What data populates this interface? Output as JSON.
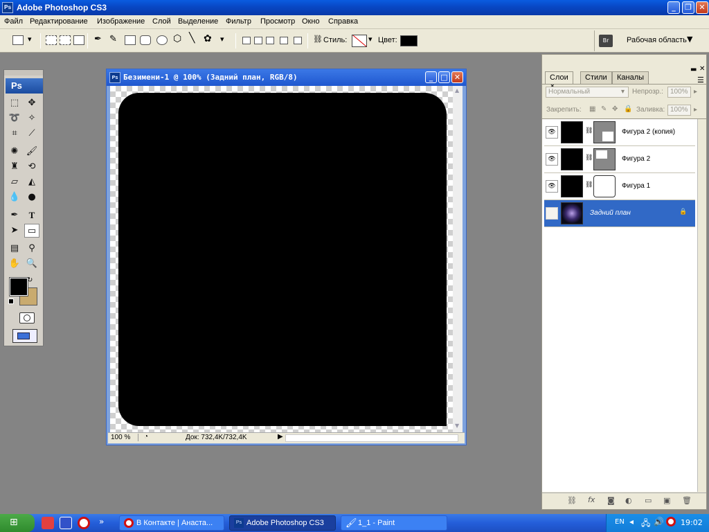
{
  "app": {
    "title": "Adobe Photoshop CS3",
    "ps_icon": "Ps"
  },
  "menu": [
    "Файл",
    "Редактирование",
    "Изображение",
    "Слой",
    "Выделение",
    "Фильтр",
    "Просмотр",
    "Окно",
    "Справка"
  ],
  "options_bar": {
    "style_label": "Стиль:",
    "color_label": "Цвет:",
    "color_value": "#000000",
    "workspace_label": "Рабочая область"
  },
  "toolbox": {
    "logo": "Ps",
    "foreground_color": "#000000",
    "background_color": "#c9ab6f",
    "tools": [
      "marquee-icon",
      "move-icon",
      "lasso-icon",
      "magic-wand-icon",
      "crop-icon",
      "slice-icon",
      "healing-brush-icon",
      "brush-icon",
      "clone-stamp-icon",
      "history-brush-icon",
      "eraser-icon",
      "paint-bucket-icon",
      "blur-icon",
      "dodge-icon",
      "pen-icon",
      "type-icon",
      "path-selection-icon",
      "rectangle-icon",
      "notes-icon",
      "eyedropper-icon",
      "hand-icon",
      "zoom-icon"
    ]
  },
  "document": {
    "title": "Безимени-1 @ 100% (Задний план, RGB/8)",
    "zoom": "100 %",
    "doc_info": "Док: 732,4K/732,4K",
    "shape_color": "#000000"
  },
  "layers_panel": {
    "tabs": [
      "Слои",
      "Стили",
      "Каналы"
    ],
    "blend_mode": "Нормальный",
    "opacity_label": "Непрозр.:",
    "opacity_value": "100%",
    "lock_label": "Закрепить:",
    "fill_label": "Заливка:",
    "fill_value": "100%",
    "layers": [
      {
        "name": "Фигура 2 (копия)",
        "visible": true,
        "selected": false
      },
      {
        "name": "Фигура 2",
        "visible": true,
        "selected": false
      },
      {
        "name": "Фигура 1",
        "visible": true,
        "selected": false
      },
      {
        "name": "Задний план",
        "visible": false,
        "selected": true
      }
    ]
  },
  "taskbar": {
    "tasks": [
      {
        "label": "В Контакте | Анаста...",
        "active": false
      },
      {
        "label": "Adobe Photoshop CS3",
        "active": true
      },
      {
        "label": "1_1 - Paint",
        "active": false
      }
    ],
    "language": "EN",
    "clock": "19:02"
  }
}
